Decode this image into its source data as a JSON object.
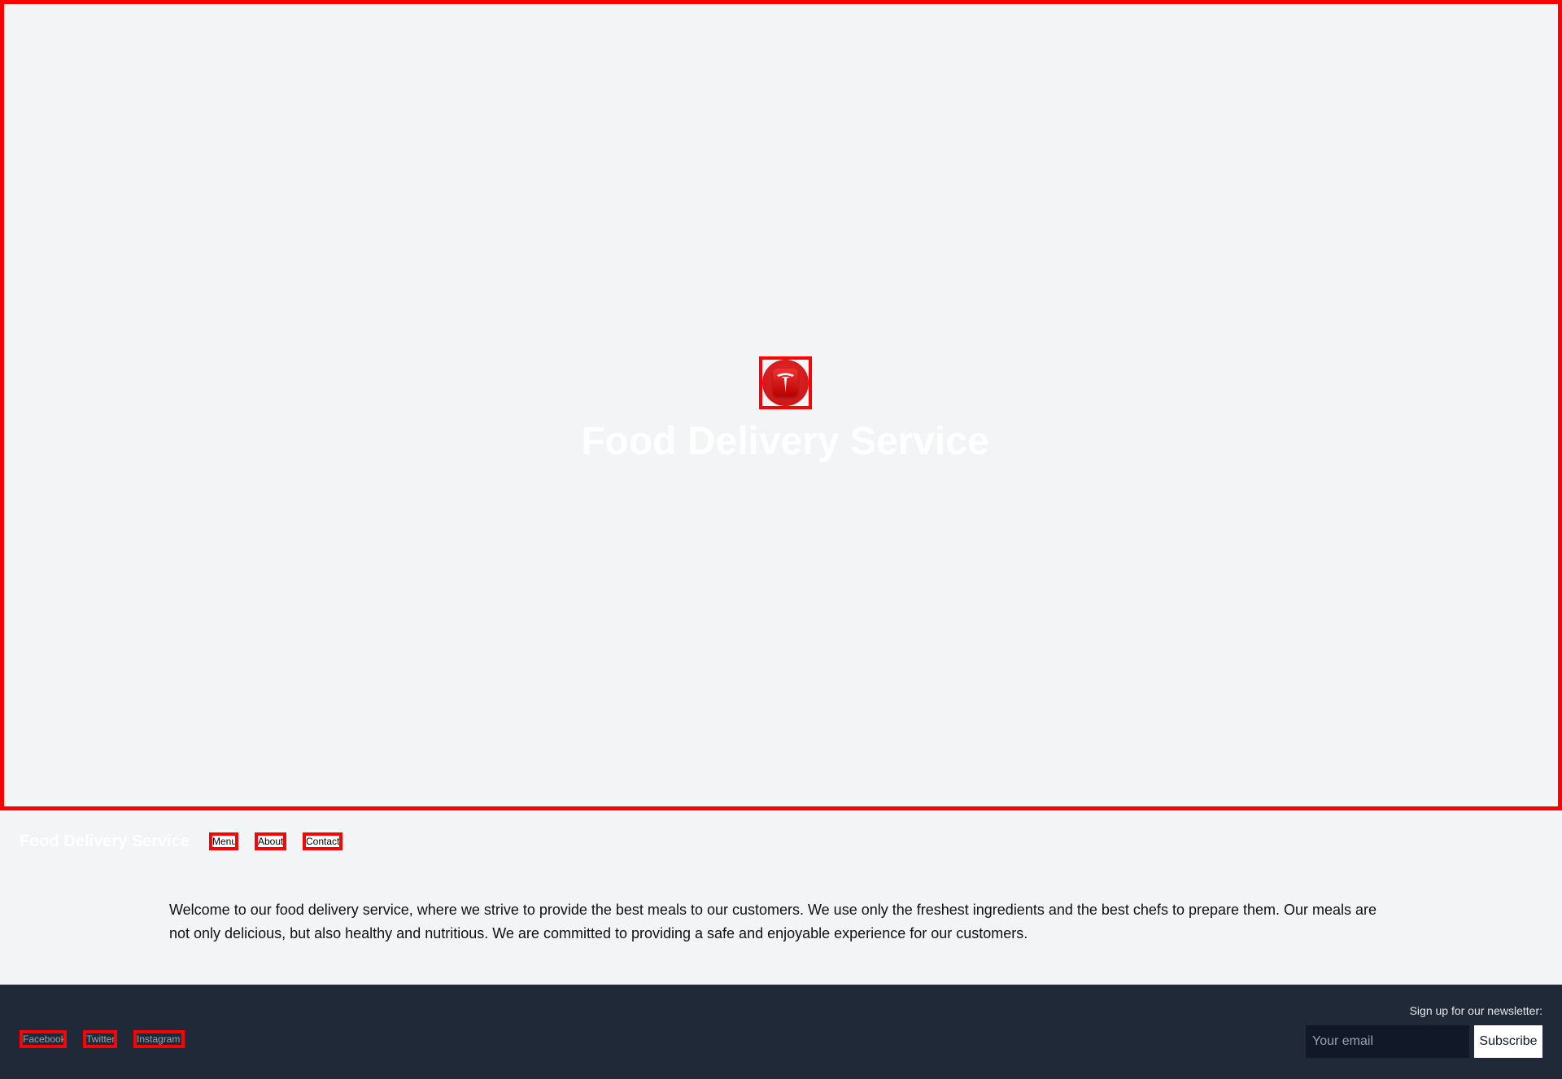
{
  "hero": {
    "title": "Food Delivery Service",
    "logo_icon": "tesla-logo-icon"
  },
  "nav": {
    "brand": "Food Delivery Service",
    "links": [
      "Menu",
      "About",
      "Contact"
    ]
  },
  "intro": "Welcome to our food delivery service, where we strive to provide the best meals to our customers. We use only the freshest ingredients and the best chefs to prepare them. Our meals are not only delicious, but also healthy and nutritious. We are committed to providing a safe and enjoyable experience for our customers.",
  "footer": {
    "social": [
      "Facebook",
      "Twitter",
      "Instagram"
    ],
    "newsletter_label": "Sign up for our newsletter:",
    "email_placeholder": "Your email",
    "subscribe_label": "Subscribe"
  },
  "colors": {
    "footer_bg": "#1f2937",
    "outline": "#ff0000",
    "page_bg": "#f3f4f6"
  }
}
